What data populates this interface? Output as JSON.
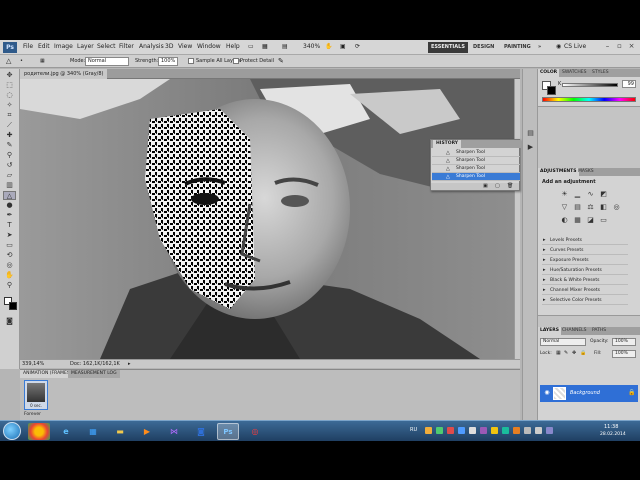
{
  "menubar": {
    "logo": "Ps",
    "items": [
      "File",
      "Edit",
      "Image",
      "Layer",
      "Select",
      "Filter",
      "Analysis",
      "3D",
      "View",
      "Window",
      "Help"
    ],
    "zoom": "340%",
    "workspaces": [
      "ESSENTIALS",
      "DESIGN",
      "PAINTING"
    ],
    "more": "»",
    "cs_live": "CS Live"
  },
  "options": {
    "mode_label": "Mode:",
    "mode_value": "Normal",
    "strength_label": "Strength:",
    "strength_value": "100%",
    "sample_all_layers": "Sample All Layers",
    "protect_detail": "Protect Detail"
  },
  "document": {
    "tab_title": "родители.jpg @ 340% (Gray/8)",
    "status_zoom": "339,14%",
    "status_doc": "Doc: 162,1K/162,1K"
  },
  "history": {
    "title": "HISTORY",
    "items": [
      "Sharpen Tool",
      "Sharpen Tool",
      "Sharpen Tool",
      "Sharpen Tool"
    ]
  },
  "color_panel": {
    "tabs": [
      "COLOR",
      "SWATCHES",
      "STYLES"
    ],
    "channel_label": "K",
    "channel_value": "99"
  },
  "adjustments": {
    "tabs": [
      "ADJUSTMENTS",
      "MASKS"
    ],
    "title": "Add an adjustment",
    "presets": [
      "Levels Presets",
      "Curves Presets",
      "Exposure Presets",
      "Hue/Saturation Presets",
      "Black & White Presets",
      "Channel Mixer Presets",
      "Selective Color Presets"
    ]
  },
  "layers": {
    "tabs": [
      "LAYERS",
      "CHANNELS",
      "PATHS"
    ],
    "blend_mode": "Normal",
    "opacity_label": "Opacity:",
    "opacity_value": "100%",
    "lock_label": "Lock:",
    "fill_label": "Fill:",
    "fill_value": "100%",
    "layer_name": "Background"
  },
  "animation": {
    "tabs": [
      "ANIMATION (FRAMES)",
      "MEASUREMENT LOG"
    ],
    "frame_label": "0 sec.",
    "loop_label": "Forever"
  },
  "taskbar": {
    "lang": "RU",
    "time": "11:38",
    "date": "28.02.2014"
  }
}
